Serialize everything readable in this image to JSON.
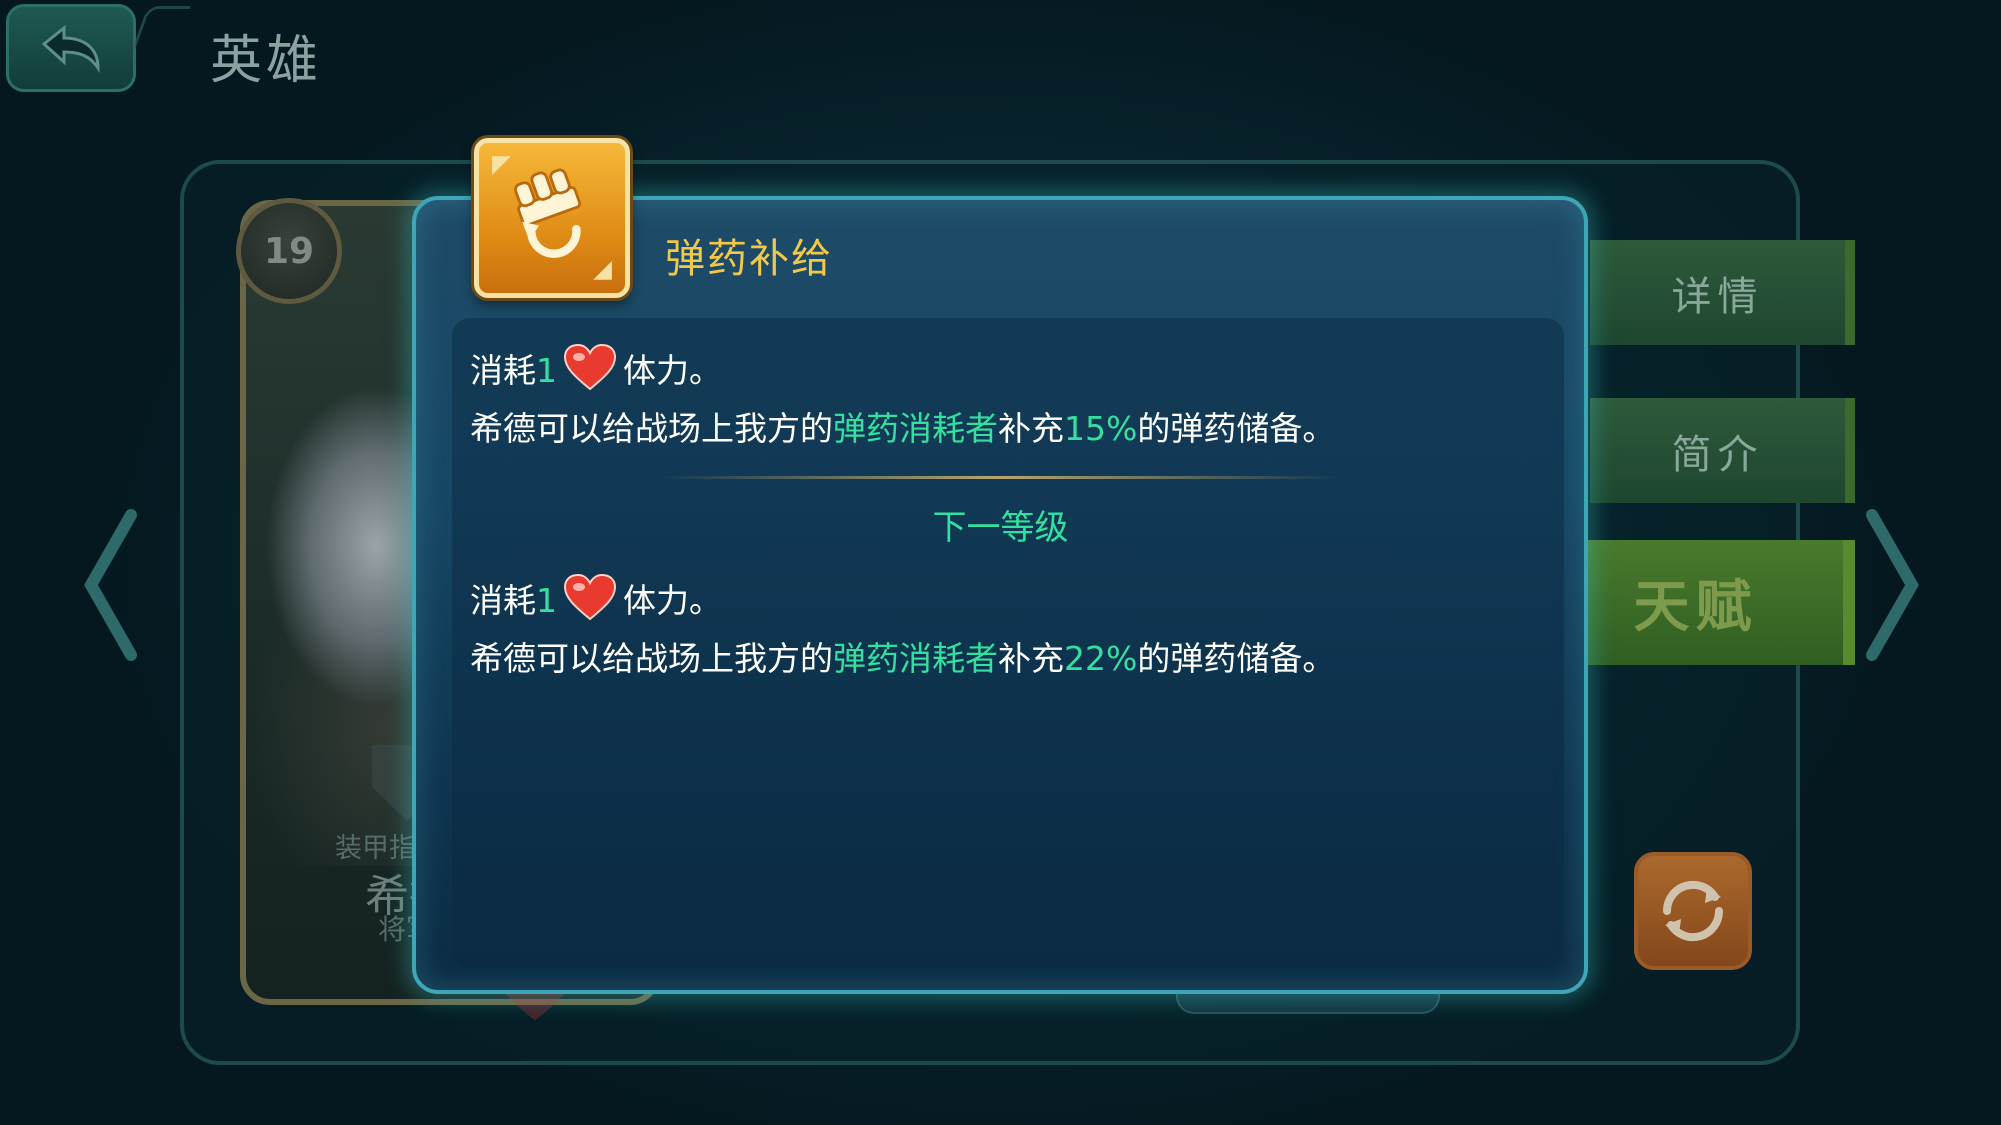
{
  "header": {
    "title": "英雄",
    "back_icon": "back-arrow-icon"
  },
  "hero": {
    "level": "19",
    "role": "装甲指挥官",
    "name": "希德",
    "rank": "将军"
  },
  "side_tabs": {
    "details": "详情",
    "intro": "简介",
    "talent": "天赋"
  },
  "background": {
    "counter": "0"
  },
  "popup": {
    "skill_name": "弹药补给",
    "skill_icon": "ammo-supply-icon",
    "current": {
      "cost_prefix": "消耗",
      "cost_value": "1",
      "cost_suffix": "体力。",
      "desc_prefix": "希德可以给战场上我方的",
      "desc_target": "弹药消耗者",
      "desc_mid": "补充",
      "desc_percent": "15%",
      "desc_suffix": "的弹药储备。"
    },
    "next_level_label": "下一等级",
    "next": {
      "cost_prefix": "消耗",
      "cost_value": "1",
      "cost_suffix": "体力。",
      "desc_prefix": "希德可以给战场上我方的",
      "desc_target": "弹药消耗者",
      "desc_mid": "补充",
      "desc_percent": "22%",
      "desc_suffix": "的弹药储备。"
    }
  },
  "colors": {
    "highlight": "#34e0a0",
    "skill_title": "#f2c84a",
    "popup_border": "#3ea6b6"
  }
}
